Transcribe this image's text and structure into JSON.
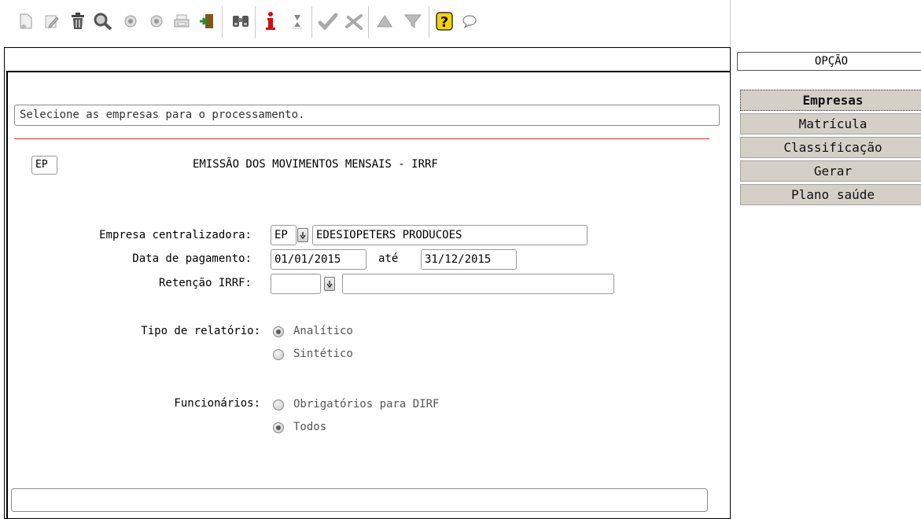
{
  "toolbar": {
    "icons": [
      "new-document-icon",
      "edit-icon",
      "delete-trash-icon",
      "search-magnifier-icon",
      "previous-circle-icon",
      "next-circle-icon",
      "print-icon",
      "exit-door-icon",
      "binoculars-icon",
      "info-icon",
      "hourglass-icon",
      "check-icon",
      "cancel-icon",
      "triangle-up-icon",
      "filter-icon",
      "help-question-icon",
      "chat-bubble-icon"
    ]
  },
  "hint": "Selecione as empresas para o processamento.",
  "header": {
    "code": "EP",
    "title": "EMISSÃO DOS MOVIMENTOS MENSAIS - IRRF"
  },
  "form": {
    "empresa_label": "Empresa centralizadora:",
    "empresa_code": "EP",
    "empresa_name": "EDESIOPETERS PRODUCOES",
    "data_label": "Data de pagamento:",
    "data_inicio": "01/01/2015",
    "ate_label": "até",
    "data_fim": "31/12/2015",
    "retencao_label": "Retenção IRRF:",
    "retencao_code": "",
    "retencao_desc": "",
    "tipo_label": "Tipo de relatório:",
    "tipo_options": [
      {
        "label": "Analítico",
        "selected": true
      },
      {
        "label": "Sintético",
        "selected": false
      }
    ],
    "func_label": "Funcionários:",
    "func_options": [
      {
        "label": "Obrigatórios para DIRF",
        "selected": false
      },
      {
        "label": "Todos",
        "selected": true
      }
    ]
  },
  "side_menu": {
    "header": "OPÇÃO",
    "items": [
      "Empresas",
      "Matrícula",
      "Classificação",
      "Gerar",
      "Plano saúde"
    ],
    "active": "Empresas"
  },
  "colors": {
    "menu_bg": "#d4d0c8",
    "separator_red": "#d23a3a"
  }
}
